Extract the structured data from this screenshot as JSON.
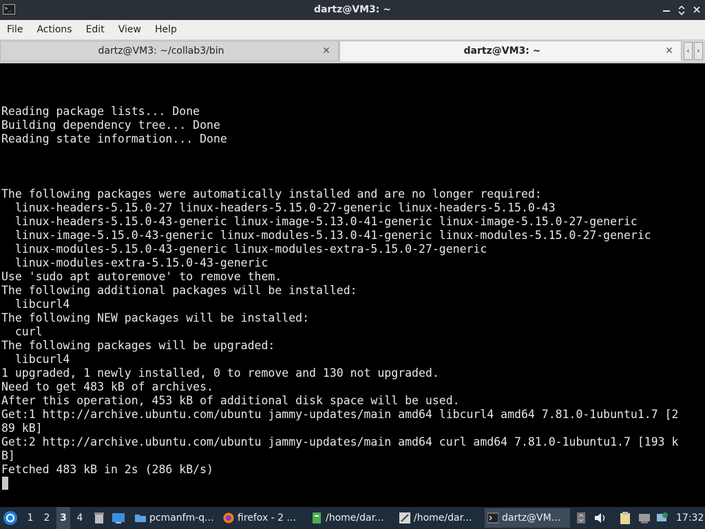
{
  "window": {
    "title": "dartz@VM3: ~",
    "app_icon_glyph": ">_",
    "buttons": [
      "minimize",
      "maximize",
      "close"
    ]
  },
  "menu": [
    "File",
    "Actions",
    "Edit",
    "View",
    "Help"
  ],
  "tabs": [
    {
      "label": "dartz@VM3: ~/collab3/bin",
      "active": false
    },
    {
      "label": "dartz@VM3: ~",
      "active": true
    }
  ],
  "terminal": {
    "lines": [
      "Reading package lists... Done",
      "Building dependency tree... Done",
      "Reading state information... Done",
      "",
      "",
      "",
      "The following packages were automatically installed and are no longer required:",
      "  linux-headers-5.15.0-27 linux-headers-5.15.0-27-generic linux-headers-5.15.0-43",
      "  linux-headers-5.15.0-43-generic linux-image-5.13.0-41-generic linux-image-5.15.0-27-generic",
      "  linux-image-5.15.0-43-generic linux-modules-5.13.0-41-generic linux-modules-5.15.0-27-generic",
      "  linux-modules-5.15.0-43-generic linux-modules-extra-5.15.0-27-generic",
      "  linux-modules-extra-5.15.0-43-generic",
      "Use 'sudo apt autoremove' to remove them.",
      "The following additional packages will be installed:",
      "  libcurl4",
      "The following NEW packages will be installed:",
      "  curl",
      "The following packages will be upgraded:",
      "  libcurl4",
      "1 upgraded, 1 newly installed, 0 to remove and 130 not upgraded.",
      "Need to get 483 kB of archives.",
      "After this operation, 453 kB of additional disk space will be used.",
      "Get:1 http://archive.ubuntu.com/ubuntu jammy-updates/main amd64 libcurl4 amd64 7.81.0-1ubuntu1.7 [2",
      "89 kB]",
      "Get:2 http://archive.ubuntu.com/ubuntu jammy-updates/main amd64 curl amd64 7.81.0-1ubuntu1.7 [193 k",
      "B]",
      "Fetched 483 kB in 2s (286 kB/s)"
    ]
  },
  "taskbar": {
    "desktops": [
      "1",
      "2",
      "3",
      "4"
    ],
    "active_desktop": "3",
    "tasks": [
      {
        "label": "pcmanfm-q...",
        "icon": "folder-icon"
      },
      {
        "label": "firefox - 2 ...",
        "icon": "firefox-icon"
      },
      {
        "label": "/home/dar...",
        "icon": "text-editor-icon"
      },
      {
        "label": "/home/dar...",
        "icon": "feather-editor-icon"
      },
      {
        "label": "dartz@VM...",
        "icon": "terminal-icon",
        "active": true
      }
    ],
    "clock": "17:32"
  },
  "colors": {
    "titlebar_bg": "#2a3037",
    "menubar_bg": "#efefef",
    "terminal_bg": "#000000",
    "terminal_fg": "#e8e8e8",
    "taskbar_bg": "#1f2c3b"
  }
}
